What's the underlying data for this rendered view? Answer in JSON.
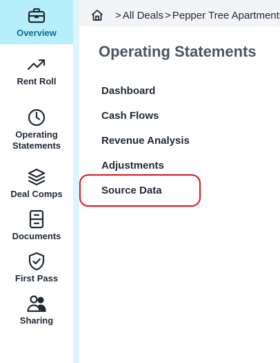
{
  "sidebar": {
    "items": [
      {
        "label": "Overview",
        "icon": "briefcase-icon",
        "active": true
      },
      {
        "label": "Rent Roll",
        "icon": "trending-up-icon",
        "active": false
      },
      {
        "label": "Operating Statements",
        "icon": "clock-icon",
        "active": false
      },
      {
        "label": "Deal Comps",
        "icon": "layers-icon",
        "active": false
      },
      {
        "label": "Documents",
        "icon": "file-cabinet-icon",
        "active": false
      },
      {
        "label": "First Pass",
        "icon": "shield-check-icon",
        "active": false
      },
      {
        "label": "Sharing",
        "icon": "users-icon",
        "active": false
      }
    ]
  },
  "breadcrumb": {
    "home_icon": "home-icon",
    "items": [
      "All Deals",
      "Pepper Tree Apartments"
    ]
  },
  "main": {
    "title": "Operating Statements",
    "menu": [
      "Dashboard",
      "Cash Flows",
      "Revenue Analysis",
      "Adjustments",
      "Source Data"
    ]
  },
  "colors": {
    "active_bg": "#b7eefb",
    "active_text": "#0b6e8f",
    "highlight": "#e0101f"
  }
}
